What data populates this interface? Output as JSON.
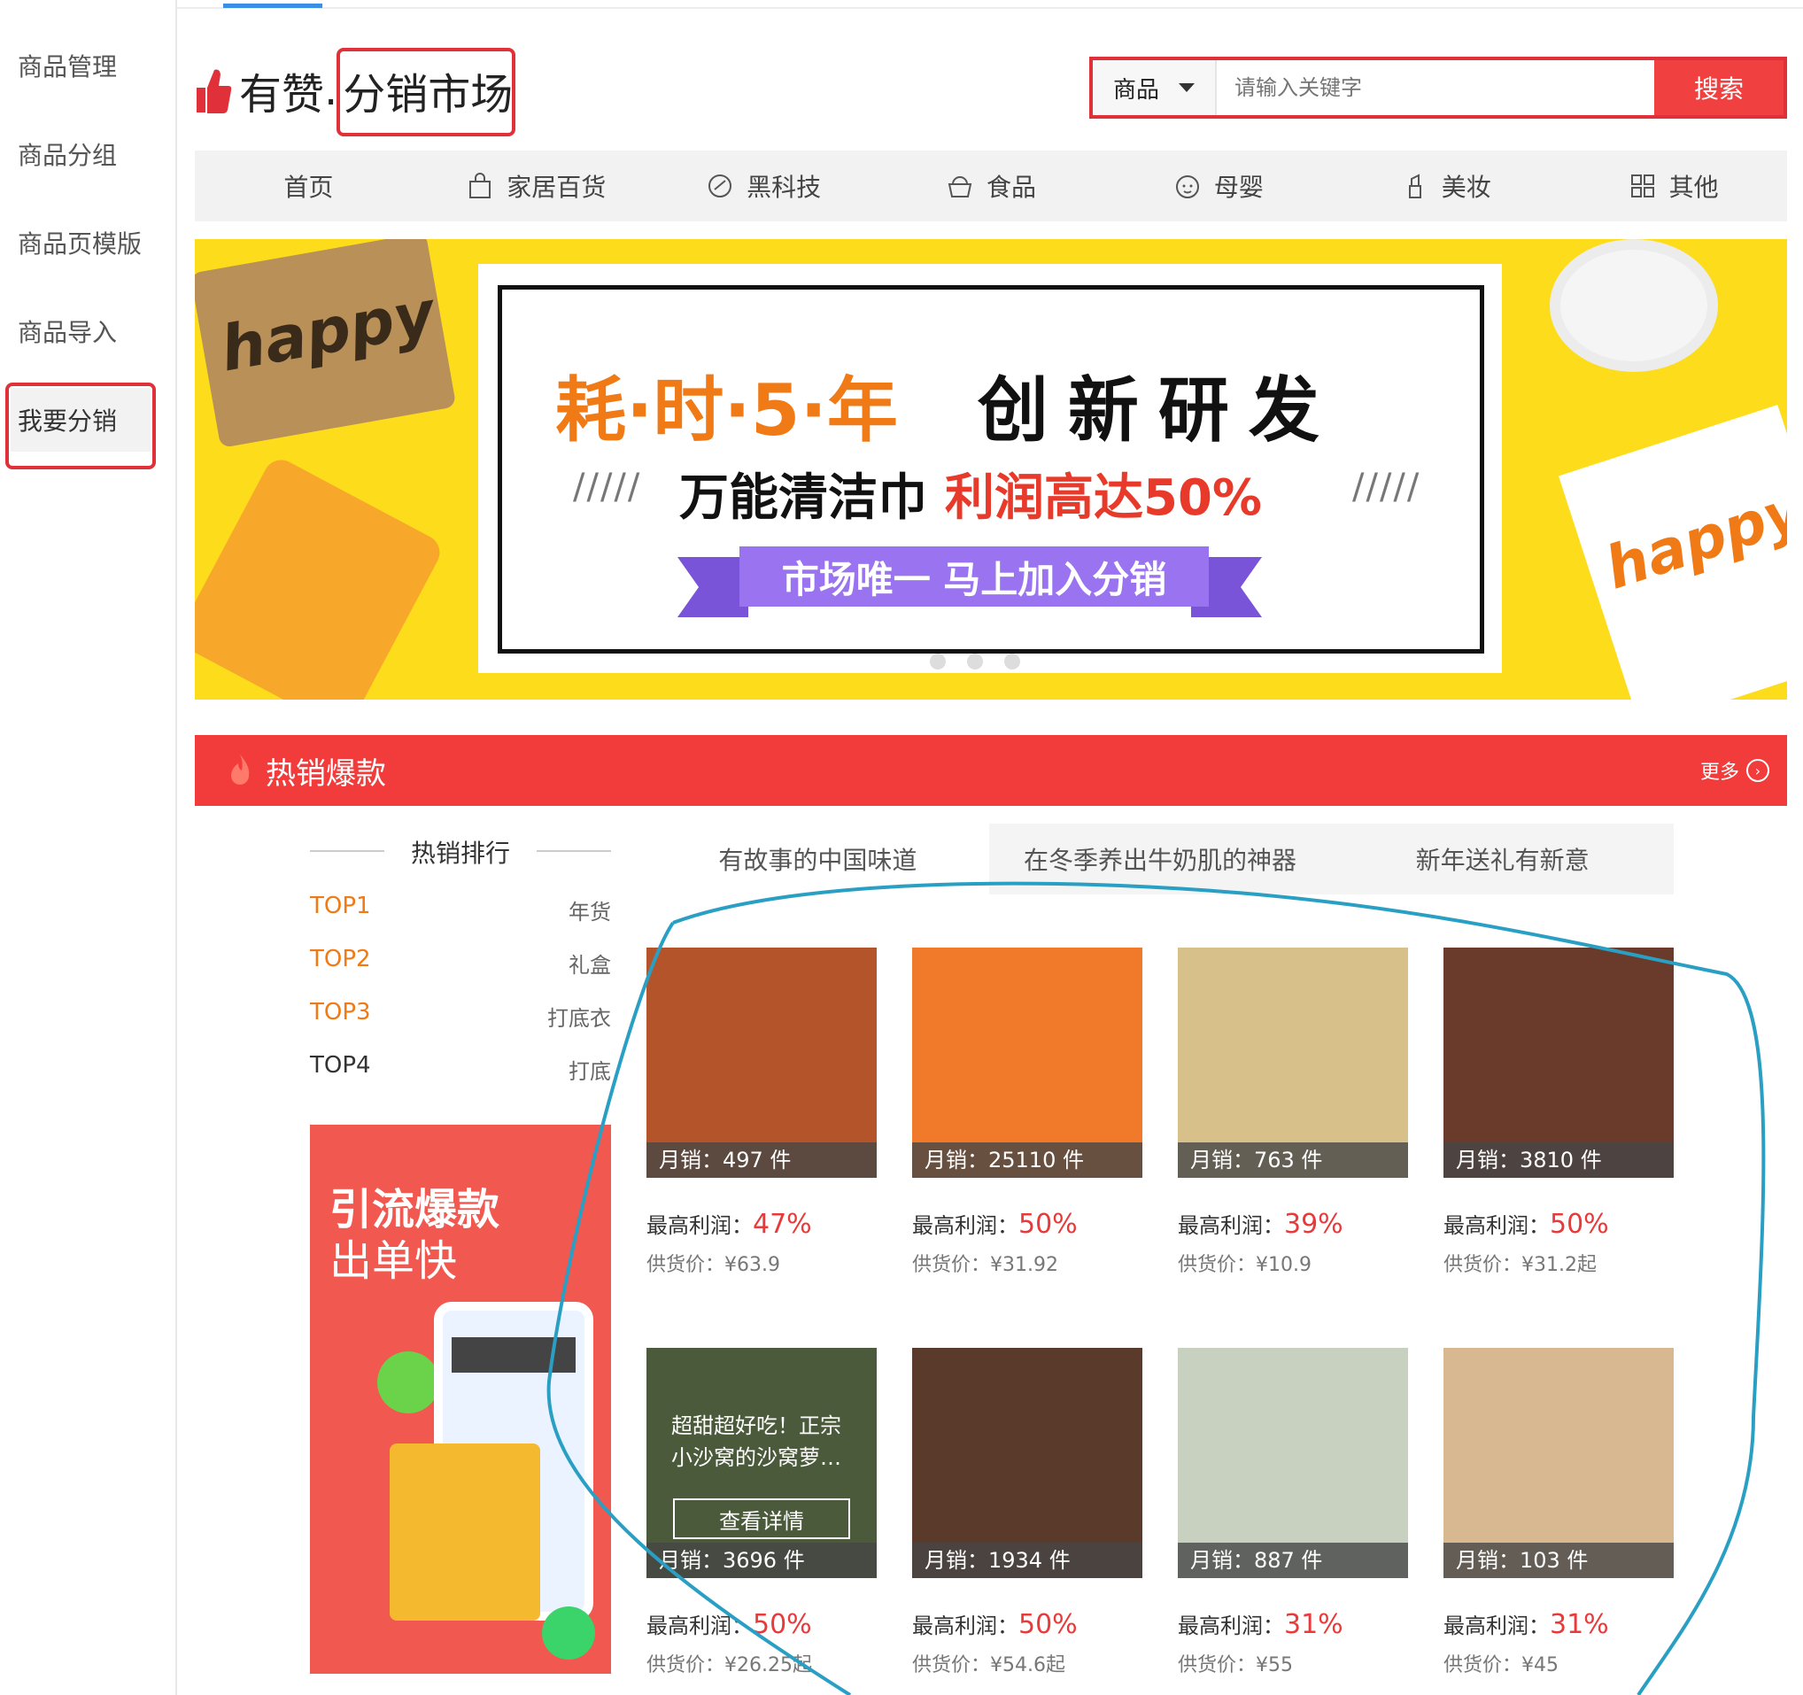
{
  "sidebar": {
    "items": [
      {
        "label": "商品管理"
      },
      {
        "label": "商品分组"
      },
      {
        "label": "商品页模版"
      },
      {
        "label": "商品导入"
      },
      {
        "label": "我要分销"
      }
    ]
  },
  "header": {
    "brand": "有赞",
    "dot": ".",
    "market": "分销市场"
  },
  "search": {
    "category": "商品",
    "placeholder": "请输入关键字",
    "button": "搜索"
  },
  "nav": [
    {
      "label": "首页",
      "icon": ""
    },
    {
      "label": "家居百货",
      "icon": "bag-icon"
    },
    {
      "label": "黑科技",
      "icon": "gadget-icon"
    },
    {
      "label": "食品",
      "icon": "basket-icon"
    },
    {
      "label": "母婴",
      "icon": "baby-icon"
    },
    {
      "label": "美妆",
      "icon": "lipstick-icon"
    },
    {
      "label": "其他",
      "icon": "grid-icon"
    }
  ],
  "banner": {
    "line1_orange": "耗·时·5·年",
    "line1_black": "创新研发",
    "line2_black": "万能清洁巾",
    "line2_red": "利润高达50%",
    "slashes": "/////",
    "ribbon": "市场唯一 马上加入分销"
  },
  "hot": {
    "title": "热销爆款",
    "more": "更多"
  },
  "ranking": {
    "title": "热销排行",
    "rows": [
      {
        "top": "TOP1",
        "cat": "年货"
      },
      {
        "top": "TOP2",
        "cat": "礼盒"
      },
      {
        "top": "TOP3",
        "cat": "打底衣"
      },
      {
        "top": "TOP4",
        "cat": "打底"
      }
    ]
  },
  "promo": {
    "line1": "引流爆款",
    "line2": "出单快"
  },
  "tabs": [
    {
      "label": "有故事的中国味道"
    },
    {
      "label": "在冬季养出牛奶肌的神器"
    },
    {
      "label": "新年送礼有新意"
    }
  ],
  "products": [
    {
      "sales": "月销：497 件",
      "profit_label": "最高利润：",
      "profit": "47%",
      "supply": "供货价：¥63.9",
      "color": "#b4542a"
    },
    {
      "sales": "月销：25110 件",
      "profit_label": "最高利润：",
      "profit": "50%",
      "supply": "供货价：¥31.92",
      "color": "#f07a2a"
    },
    {
      "sales": "月销：763 件",
      "profit_label": "最高利润：",
      "profit": "39%",
      "supply": "供货价：¥10.9",
      "color": "#d8c08a"
    },
    {
      "sales": "月销：3810 件",
      "profit_label": "最高利润：",
      "profit": "50%",
      "supply": "供货价：¥31.2起",
      "color": "#6a3a2a"
    },
    {
      "sales": "月销：3696 件",
      "profit_label": "最高利润：",
      "profit": "50%",
      "supply": "供货价：¥26.25起",
      "color": "#4a5a3a",
      "overlay": "超甜超好吃！正宗小沙窝的沙窝萝…",
      "button": "查看详情"
    },
    {
      "sales": "月销：1934 件",
      "profit_label": "最高利润：",
      "profit": "50%",
      "supply": "供货价：¥54.6起",
      "color": "#5a3a2a"
    },
    {
      "sales": "月销：887 件",
      "profit_label": "最高利润：",
      "profit": "31%",
      "supply": "供货价：¥55",
      "color": "#c8d0c0"
    },
    {
      "sales": "月销：103 件",
      "profit_label": "最高利润：",
      "profit": "31%",
      "supply": "供货价：¥45",
      "color": "#d8b890"
    }
  ],
  "colors": {
    "accent_red": "#e0313a",
    "hot_bar": "#f23b3b",
    "annotation_blue": "#2a9fc4"
  }
}
